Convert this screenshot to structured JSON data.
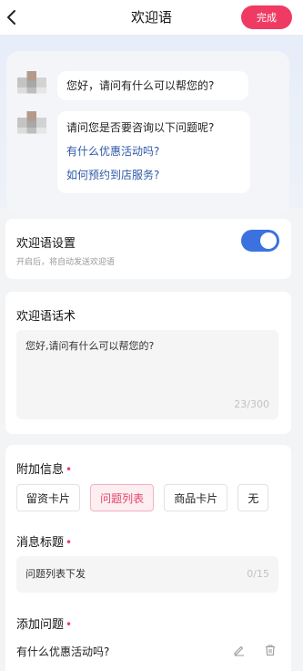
{
  "header": {
    "title": "欢迎语",
    "done_label": "完成"
  },
  "preview": {
    "greeting": "您好，请问有什么可以帮您的?",
    "ask": "请问您是否要咨询以下问题呢?",
    "questions": [
      "有什么优惠活动吗?",
      "如何预约到店服务?"
    ]
  },
  "toggle": {
    "title": "欢迎语设置",
    "desc": "开启后，将自动发送欢迎语",
    "enabled": true
  },
  "script": {
    "title": "欢迎语话术",
    "text": "您好,请问有什么可以帮您的?",
    "counter": "23/300"
  },
  "extra": {
    "title": "附加信息",
    "required_mark": "•",
    "chips": [
      "留资卡片",
      "问题列表",
      "商品卡片",
      "无"
    ],
    "active_chip": "问题列表",
    "message_title_label": "消息标题",
    "message_title_value": "问题列表下发",
    "message_title_counter": "0/15",
    "add_question_label": "添加问题",
    "question_item": "有什么优惠活动吗?"
  },
  "colors": {
    "accent": "#ef3b63",
    "switch": "#3b72df",
    "link": "#2f5aa8"
  }
}
